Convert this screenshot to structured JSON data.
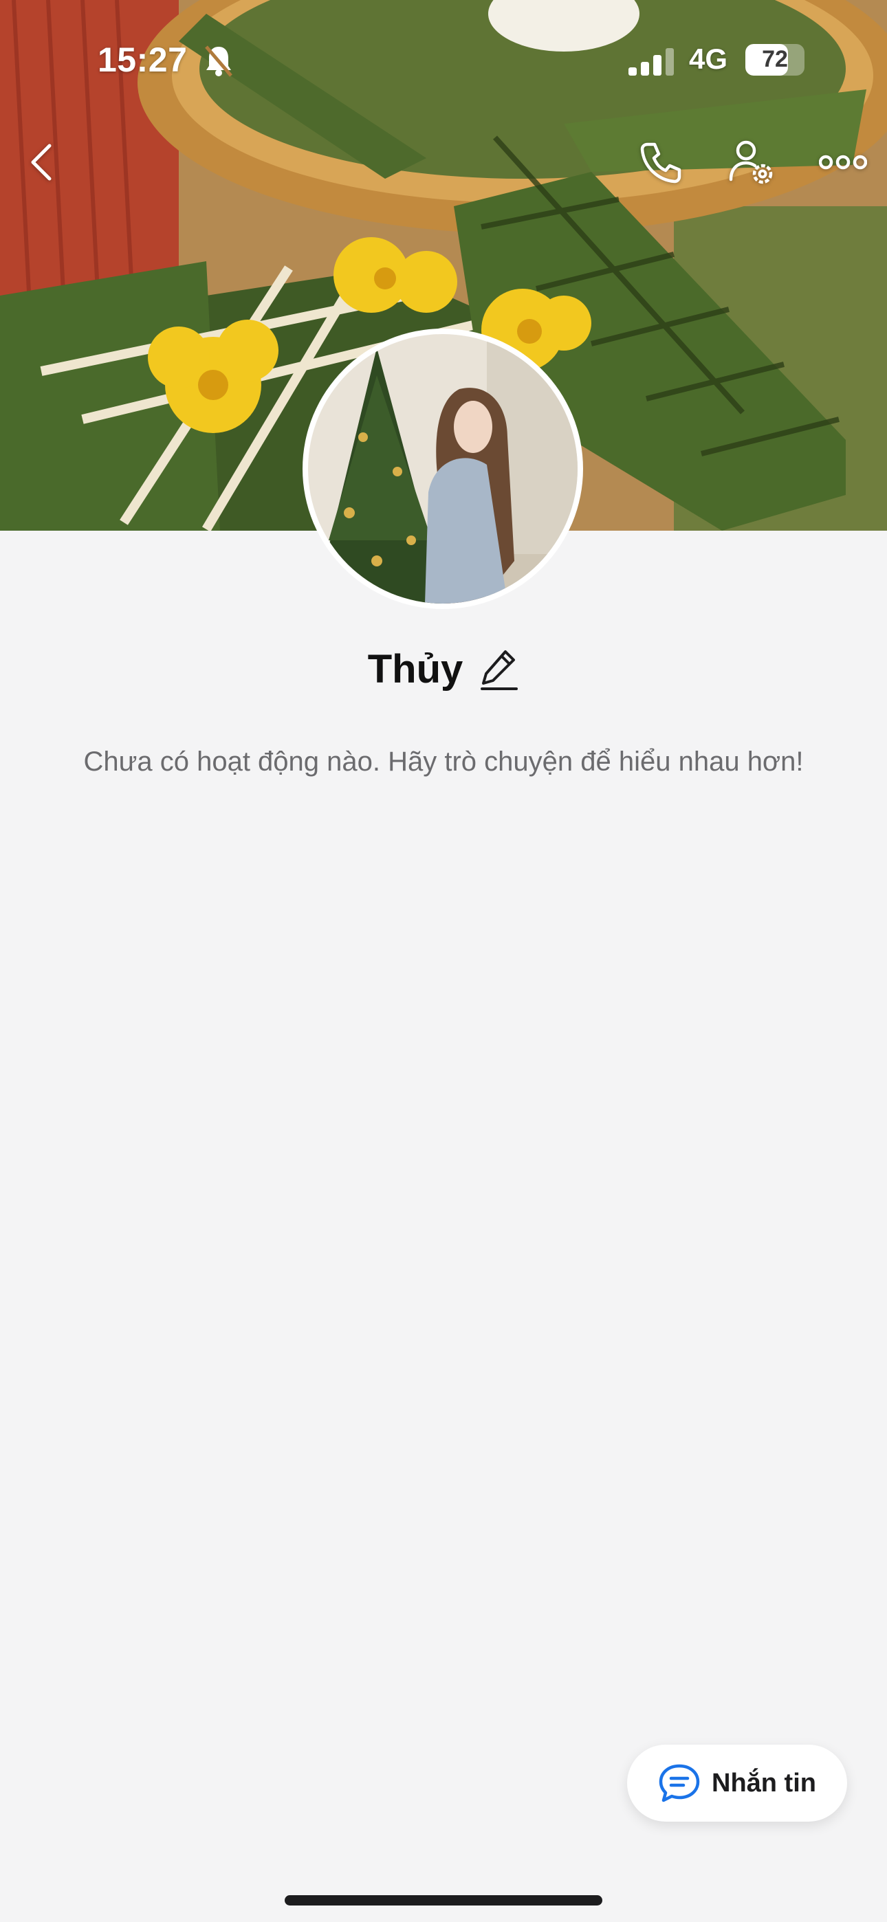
{
  "status_bar": {
    "time": "15:27",
    "network": "4G",
    "battery": "72",
    "battery_level": 0.72
  },
  "nav": {
    "back_icon": "chevron-left-icon",
    "call_icon": "phone-icon",
    "settings_icon": "user-settings-icon",
    "more_icon": "more-dots-icon"
  },
  "profile": {
    "name": "Thủy",
    "edit_icon": "pencil-icon",
    "empty_activity": "Chưa có hoạt động nào. Hãy trò chuyện để hiểu nhau hơn!"
  },
  "message_button": {
    "label": "Nhắn tin",
    "icon": "chat-bubble-icon",
    "accent": "#1a73e8"
  },
  "colors": {
    "background": "#f4f4f5",
    "text_primary": "#111111",
    "text_secondary": "#6b6b6e"
  }
}
